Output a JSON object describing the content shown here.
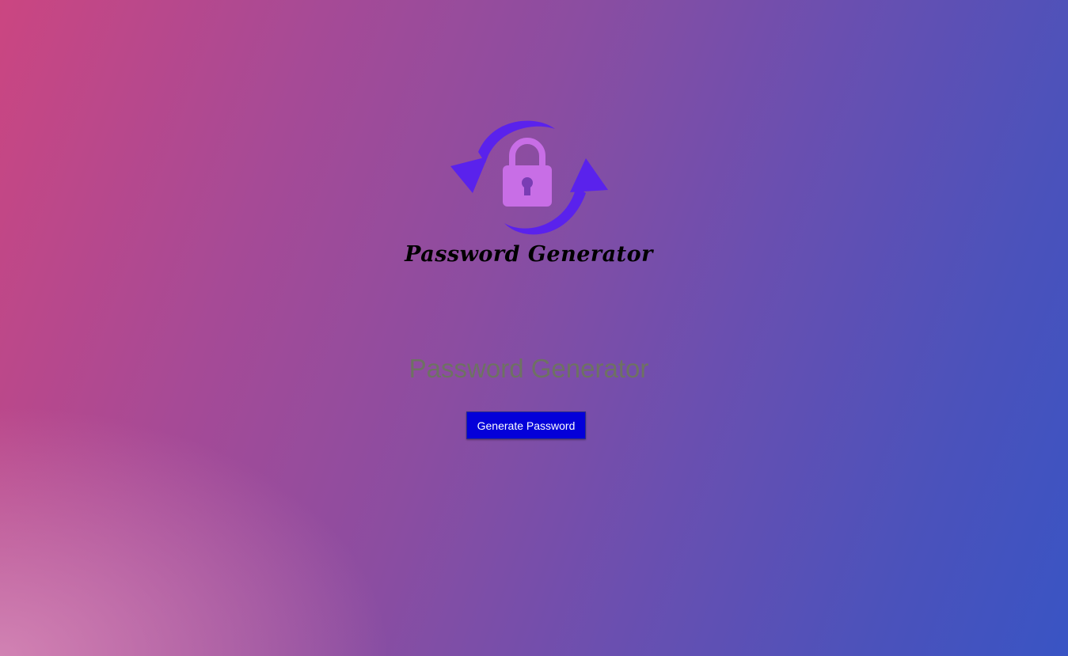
{
  "logo": {
    "icon": "lock-refresh-icon",
    "text": "Password Generator",
    "colors": {
      "arrows": "#5a22ec",
      "lock": "#c86ee6",
      "keyhole": "#7a3db4"
    }
  },
  "main": {
    "heading": "Password Generator",
    "generate_label": "Generate Password"
  },
  "colors": {
    "heading_text": "#6e7262",
    "button_background": "#0400d9",
    "button_text": "#ffffff",
    "background_start": "#cb4681",
    "background_end": "#3954c4"
  }
}
